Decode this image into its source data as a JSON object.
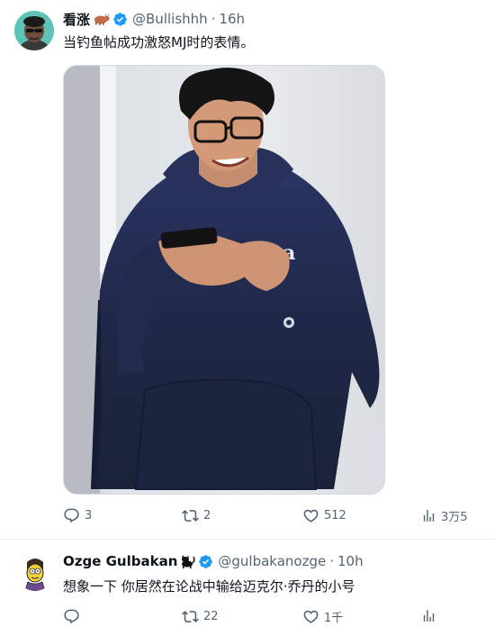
{
  "tweet1": {
    "author": {
      "name": "看涨",
      "name_emoji": "ox-emoji",
      "verified": true,
      "handle": "@Bullishhh",
      "time": "16h"
    },
    "separator": "·",
    "text": "当钓鱼帖成功激怒MJ时的表情。",
    "media": {
      "description_icon": "photo",
      "shirt_print": "Dea"
    },
    "actions": {
      "replies": "3",
      "retweets": "2",
      "likes": "512",
      "views": "3万5"
    }
  },
  "tweet2": {
    "author": {
      "name": "Ozge Gulbakan",
      "name_emoji": "black-cat-emoji",
      "verified": true,
      "handle": "@gulbakanozge",
      "time": "10h"
    },
    "separator": "·",
    "text": "想象一下 你居然在论战中输给迈克尔·乔丹的小号",
    "actions": {
      "replies": "",
      "retweets": "22",
      "likes": "1千",
      "views": ""
    }
  },
  "colors": {
    "text_primary": "#0f1419",
    "text_secondary": "#536471",
    "verified_blue": "#1d9bf0",
    "divider": "#eff3f4"
  }
}
